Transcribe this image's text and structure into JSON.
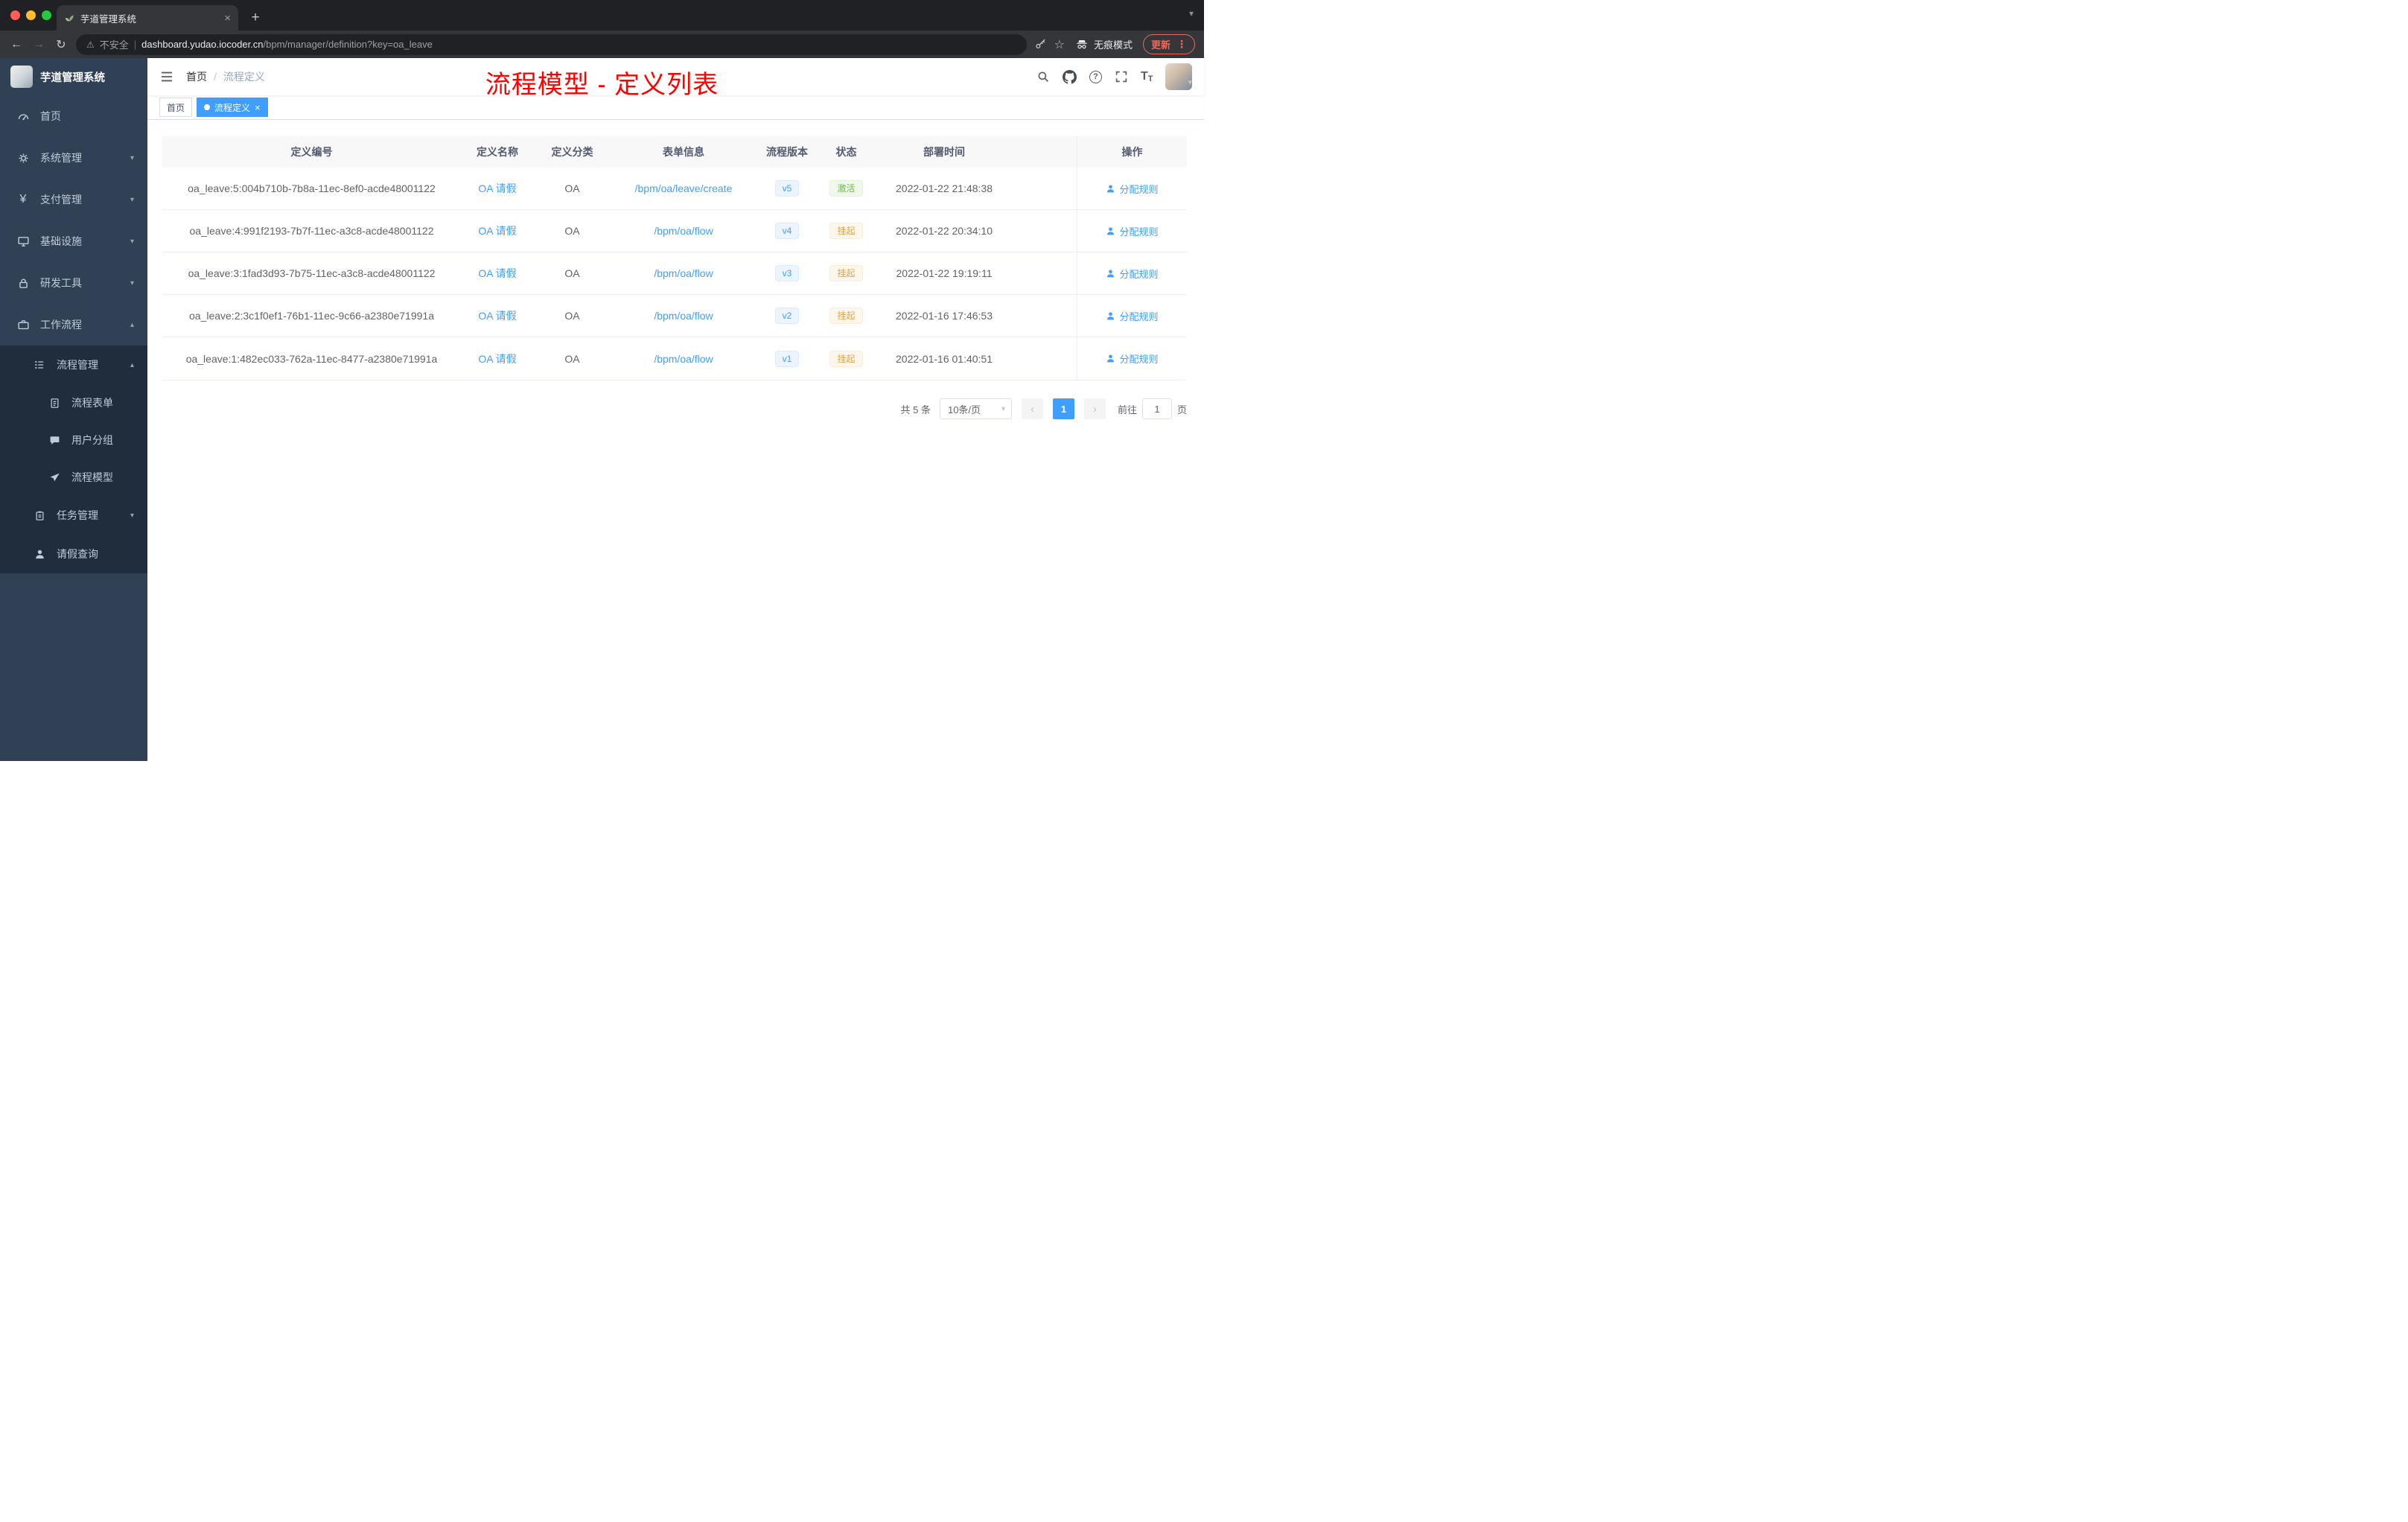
{
  "browser": {
    "tab_title": "芋道管理系统",
    "security_label": "不安全",
    "url_host": "dashboard.yudao.iocoder.cn",
    "url_path": "/bpm/manager/definition?key=oa_leave",
    "incognito_label": "无痕模式",
    "update_label": "更新"
  },
  "sidebar": {
    "app_title": "芋道管理系统",
    "menu": {
      "home": "首页",
      "system": "系统管理",
      "payment": "支付管理",
      "infrastructure": "基础设施",
      "devtools": "研发工具",
      "workflow": "工作流程",
      "process_management": "流程管理",
      "process_form": "流程表单",
      "user_group": "用户分组",
      "process_model": "流程模型",
      "task_management": "任务管理",
      "leave_query": "请假查询"
    }
  },
  "navbar": {
    "breadcrumb_home": "首页",
    "breadcrumb_separator": "/",
    "breadcrumb_current": "流程定义",
    "annotation_title": "流程模型 - 定义列表"
  },
  "tags_view": {
    "home_tag": "首页",
    "active_tag": "流程定义"
  },
  "table": {
    "headers": {
      "id": "定义编号",
      "name": "定义名称",
      "category": "定义分类",
      "form": "表单信息",
      "version": "流程版本",
      "status": "状态",
      "deploy_time": "部署时间",
      "actions": "操作"
    },
    "rows": [
      {
        "id": "oa_leave:5:004b710b-7b8a-11ec-8ef0-acde48001122",
        "name": "OA 请假",
        "category": "OA",
        "form": "/bpm/oa/leave/create",
        "version": "v5",
        "status": "激活",
        "deploy_time": "2022-01-22 21:48:38",
        "action": "分配规则"
      },
      {
        "id": "oa_leave:4:991f2193-7b7f-11ec-a3c8-acde48001122",
        "name": "OA 请假",
        "category": "OA",
        "form": "/bpm/oa/flow",
        "version": "v4",
        "status": "挂起",
        "deploy_time": "2022-01-22 20:34:10",
        "action": "分配规则"
      },
      {
        "id": "oa_leave:3:1fad3d93-7b75-11ec-a3c8-acde48001122",
        "name": "OA 请假",
        "category": "OA",
        "form": "/bpm/oa/flow",
        "version": "v3",
        "status": "挂起",
        "deploy_time": "2022-01-22 19:19:11",
        "action": "分配规则"
      },
      {
        "id": "oa_leave:2:3c1f0ef1-76b1-11ec-9c66-a2380e71991a",
        "name": "OA 请假",
        "category": "OA",
        "form": "/bpm/oa/flow",
        "version": "v2",
        "status": "挂起",
        "deploy_time": "2022-01-16 17:46:53",
        "action": "分配规则"
      },
      {
        "id": "oa_leave:1:482ec033-762a-11ec-8477-a2380e71991a",
        "name": "OA 请假",
        "category": "OA",
        "form": "/bpm/oa/flow",
        "version": "v1",
        "status": "挂起",
        "deploy_time": "2022-01-16 01:40:51",
        "action": "分配规则"
      }
    ]
  },
  "pagination": {
    "total_text": "共 5 条",
    "page_size_text": "10条/页",
    "current_page": "1",
    "goto_label": "前往",
    "goto_value": "1",
    "goto_unit": "页"
  },
  "colors": {
    "accent": "#409eff",
    "success": "#67c23a",
    "warning": "#e6a23c",
    "annotation_red": "#ff0000",
    "sidebar_bg": "#304156",
    "sidebar_submenu_bg": "#1f2d3d",
    "chrome_dark": "#202124"
  }
}
